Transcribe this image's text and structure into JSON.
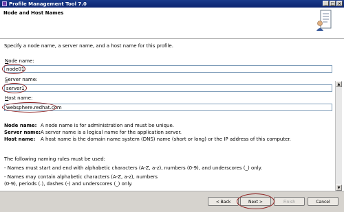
{
  "window": {
    "title": "Profile Management Tool 7.0",
    "controls": [
      "_",
      "□",
      "×"
    ]
  },
  "header": {
    "page_title": "Node and Host Names"
  },
  "main": {
    "intro": "Specify a node name, a server name, and a host name for this profile.",
    "fields": [
      {
        "label_access": "N",
        "label_rest": "ode name:",
        "value": "node01"
      },
      {
        "label_access": "S",
        "label_rest": "erver name:",
        "value": "server1"
      },
      {
        "label_access": "H",
        "label_rest": "ost name:",
        "value": "websphere.redhat.com"
      }
    ],
    "definitions": [
      {
        "term": "Node name:",
        "text": "A node name is for administration and must be unique."
      },
      {
        "term": "Server name:",
        "text": "A server name is a logical name for the application server."
      },
      {
        "term": "Host name:",
        "text": "A host name is the domain name system (DNS) name (short or long) or the IP address of this computer."
      }
    ],
    "rules_title": "The following naming rules must be used:",
    "rules": [
      "- Names must start and end with alphabetic characters (A-Z, a-z), numbers (0-9), and underscores (_) only.",
      "- Names may contain alphabetic characters (A-Z, a-z), numbers",
      "(0-9), periods (.), dashes (-) and underscores (_) only."
    ]
  },
  "footer": {
    "back": "< Back",
    "next": "Next >",
    "finish": "Finish",
    "cancel": "Cancel"
  },
  "colors": {
    "titlebar": "#0b2470",
    "annotation": "#8b1a1a",
    "footer": "#d6d3ce"
  }
}
